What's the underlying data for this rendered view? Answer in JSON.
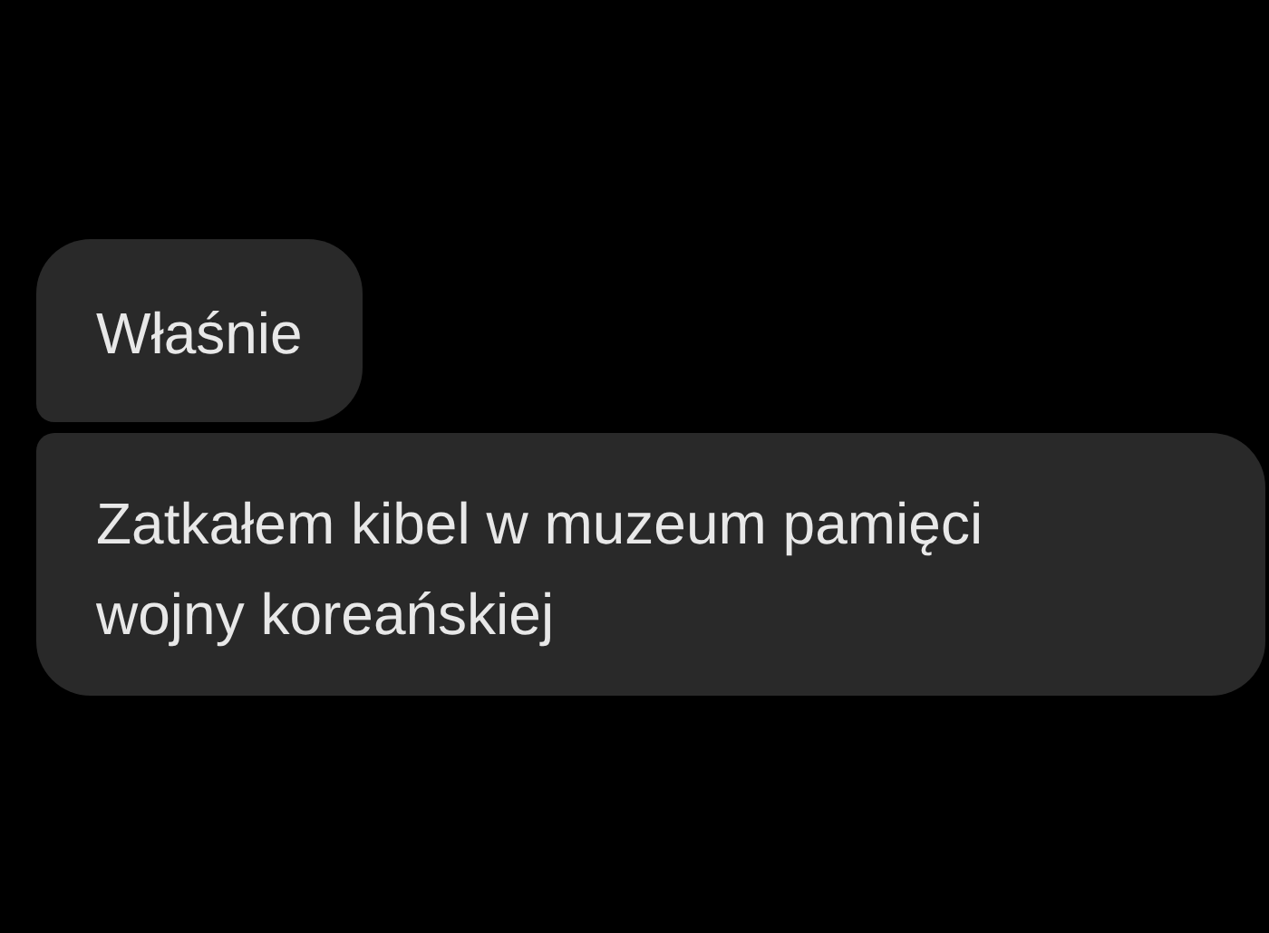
{
  "messages": [
    {
      "text": "Właśnie"
    },
    {
      "text": "Zatkałem kibel w muzeum pamięci wojny koreańskiej"
    }
  ]
}
